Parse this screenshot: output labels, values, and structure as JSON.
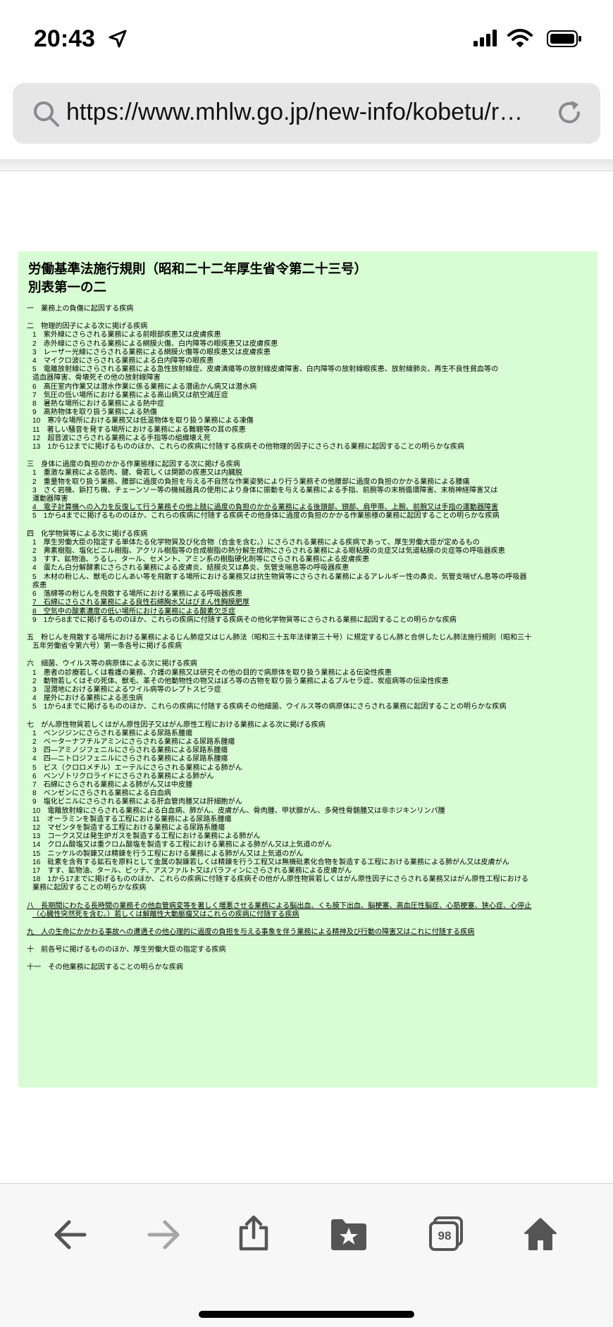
{
  "status_bar": {
    "time": "20:43",
    "location_icon": "location-arrow-icon",
    "signal_icon": "cellular-signal-icon",
    "wifi_icon": "wifi-icon",
    "battery_icon": "battery-icon"
  },
  "browser": {
    "url": "https://www.mhlw.go.jp/new-info/kobetu/r…"
  },
  "colors": {
    "document_bg": "#d8fcd3",
    "urlbar_bg": "#e6e6e7"
  },
  "document": {
    "title_line1": "労働基準法施行規則（昭和二十二年厚生省令第二十三号）",
    "title_line2": "別表第一の二",
    "sections": [
      {
        "lines": [
          {
            "text": "一　業務上の負傷に起因する疾病"
          }
        ]
      },
      {
        "lines": [
          {
            "text": "二　物理的因子による次に掲げる疾病"
          },
          {
            "text": "1　紫外線にさらされる業務による前眼部疾患又は皮膚疾患",
            "cls": "item"
          },
          {
            "text": "2　赤外線にさらされる業務による網膜火傷、白内障等の眼疾患又は皮膚疾患",
            "cls": "item"
          },
          {
            "text": "3　レーザー光線にさらされる業務による網膜火傷等の眼疾患又は皮膚疾患",
            "cls": "item"
          },
          {
            "text": "4　マイクロ波にさらされる業務による白内障等の眼疾患",
            "cls": "item"
          },
          {
            "text": "5　電離放射線にさらされる業務による急性放射線症、皮膚潰瘍等の放射線皮膚障害、白内障等の放射線眼疾患、放射線肺炎、再生不良性貧血等の",
            "cls": "item"
          },
          {
            "text": "造血器障害、骨壊死その他の放射線障害",
            "cls": "cont"
          },
          {
            "text": "6　高圧室内作業又は潜水作業に係る業務による潜函かん病又は潜水病",
            "cls": "item"
          },
          {
            "text": "7　気圧の低い場所における業務による高山病又は航空減圧症",
            "cls": "item"
          },
          {
            "text": "8　暑熱な場所における業務による熱中症",
            "cls": "item"
          },
          {
            "text": "9　高熱物体を取り扱う業務による熱傷",
            "cls": "item"
          },
          {
            "text": "10　寒冷な場所における業務又は低温物体を取り扱う業務による凍傷",
            "cls": "item"
          },
          {
            "text": "11　著しい騒音を発する場所における業務による難聴等の耳の疾患",
            "cls": "item"
          },
          {
            "text": "12　超音波にさらされる業務による手指等の組織壊え死",
            "cls": "item"
          },
          {
            "text": "13　1から12までに掲げるもののほか、これらの疾病に付随する疾病その他物理的因子にさらされる業務に起因することの明らかな疾病",
            "cls": "item"
          }
        ]
      },
      {
        "lines": [
          {
            "text": "三　身体に過度の負担のかかる作業態様に起因する次に掲げる疾病"
          },
          {
            "text": "1　重激な業務による筋肉、腱、骨若しくは関節の疾患又は内臓脱",
            "cls": "item"
          },
          {
            "text": "2　重量物を取り扱う業務、腰部に過度の負担を与える不自然な作業姿勢により行う業務その他腰部に過度の負担のかかる業務による腰痛",
            "cls": "item"
          },
          {
            "text": "3　さく岩機、鋲打ち機、チェーンソー等の機械器具の使用により身体に振動を与える業務による手指、前腕等の末梢循環障害、末梢神経障害又は",
            "cls": "item"
          },
          {
            "text": "運動器障害",
            "cls": "cont"
          },
          {
            "text": "4　電子計算機への入力を反復して行う業務その他上肢に過度の負担のかかる業務による後頭部、頸部、肩甲帯、上腕、前腕又は手指の運動器障害",
            "cls": "item ul"
          },
          {
            "text": "5　1から4までに掲げるもののほか、これらの疾病に付随する疾病その他身体に過度の負担のかかる作業態様の業務に起因することの明らかな疾病",
            "cls": "item"
          }
        ]
      },
      {
        "lines": [
          {
            "text": "四　化学物質等による次に掲げる疾病"
          },
          {
            "text": "1　厚生労働大臣の指定する単体たる化学物質及び化合物（合金を含む。）にさらされる業務による疾病であって、厚生労働大臣が定めるもの",
            "cls": "item"
          },
          {
            "text": "2　弗素樹脂、塩化ビニル樹脂、アクリル樹脂等の合成樹脂の熱分解生成物にさらされる業務による眼粘膜の炎症又は気道粘膜の炎症等の呼吸器疾患",
            "cls": "item"
          },
          {
            "text": "3　すす、鉱物油、うるし、タール、セメント、アミン系の樹脂硬化剤等にさらされる業務による皮膚疾患",
            "cls": "item"
          },
          {
            "text": "4　蛋たん白分解酵素にさらされる業務による皮膚炎、結膜炎又は鼻炎、気管支喘息等の呼吸器疾患",
            "cls": "item"
          },
          {
            "text": "5　木材の粉じん、獣毛のじんあい等を飛散する場所における業務又は抗生物質等にさらされる業務によるアレルギー性の鼻炎、気管支喘ぜん息等の呼吸器",
            "cls": "item"
          },
          {
            "text": "疾患",
            "cls": "cont"
          },
          {
            "text": "6　落綿等の粉じんを飛散する場所における業務による呼吸器疾患",
            "cls": "item"
          },
          {
            "text": "7　石綿にさらされる業務による良性石綿胸水又はびまん性胸膜肥厚",
            "cls": "item ul"
          },
          {
            "text": "8　空気中の酸素濃度の低い場所における業務による酸素欠乏症",
            "cls": "item ul"
          },
          {
            "text": "9　1から8までに掲げるもののほか、これらの疾病に付随する疾病その他化学物質等にさらされる業務に起因することの明らかな疾病",
            "cls": "item"
          }
        ]
      },
      {
        "lines": [
          {
            "text": "五　粉じんを飛散する場所における業務によるじん肺症又はじん肺法（昭和三十五年法律第三十号）に規定するじん肺と合併したじん肺法施行規則（昭和三十"
          },
          {
            "text": "五年労働省令第六号）第一条各号に掲げる疾病",
            "cls": "cont"
          }
        ]
      },
      {
        "lines": [
          {
            "text": "六　細菌、ウイルス等の病原体による次に掲げる疾病"
          },
          {
            "text": "1　患者の診療若しくは看護の業務、介護の業務又は研究その他の目的で病原体を取り扱う業務による伝染性疾患",
            "cls": "item"
          },
          {
            "text": "2　動物若しくはその死体、獣毛、革その他動物性の物又はぼろ等の古物を取り扱う業務によるブルセラ症、炭疽病等の伝染性疾患",
            "cls": "item"
          },
          {
            "text": "3　湿潤地における業務によるワイル病等のレプトスピラ症",
            "cls": "item"
          },
          {
            "text": "4　屋外における業務による恙虫病",
            "cls": "item"
          },
          {
            "text": "5　1から4までに掲げるもののほか、これらの疾病に付随する疾病その他細菌、ウイルス等の病原体にさらされる業務に起因することの明らかな疾病",
            "cls": "item"
          }
        ]
      },
      {
        "lines": [
          {
            "text": "七　がん原性物質若しくはがん原性因子又はがん原性工程における業務による次に掲げる疾病"
          },
          {
            "text": "1　ベンジジンにさらされる業務による尿路系腫瘍",
            "cls": "item"
          },
          {
            "text": "2　ベーターナフチルアミンにさらされる業務による尿路系腫瘍",
            "cls": "item"
          },
          {
            "text": "3　四―アミノジフェニルにさらされる業務による尿路系腫瘍",
            "cls": "item"
          },
          {
            "text": "4　四―ニトロジフェニルにさらされる業務による尿路系腫瘍",
            "cls": "item"
          },
          {
            "text": "5　ビス（クロロメチル）エーテルにさらされる業務による肺がん",
            "cls": "item"
          },
          {
            "text": "6　ベンゾトリクロライドにさらされる業務による肺がん",
            "cls": "item"
          },
          {
            "text": "7　石綿にさらされる業務による肺がん又は中皮腫",
            "cls": "item"
          },
          {
            "text": "8　ベンゼンにさらされる業務による白血病",
            "cls": "item"
          },
          {
            "text": "9　塩化ビニルにさらされる業務による肝血管肉腫又は肝細胞がん",
            "cls": "item"
          },
          {
            "text": "10　電離放射線にさらされる業務による白血病、肺がん、皮膚がん、骨肉腫、甲状腺がん、多発性骨髄腫又は非ホジキンリンパ腫",
            "cls": "item"
          },
          {
            "text": "11　オーラミンを製造する工程における業務による尿路系腫瘍",
            "cls": "item"
          },
          {
            "text": "12　マゼンタを製造する工程における業務による尿路系腫瘍",
            "cls": "item"
          },
          {
            "text": "13　コークス又は発生炉ガスを製造する工程における業務による肺がん",
            "cls": "item"
          },
          {
            "text": "14　クロム酸塩又は重クロム酸塩を製造する工程における業務による肺がん又は上気道のがん",
            "cls": "item"
          },
          {
            "text": "15　ニッケルの製錬又は精錬を行う工程における業務による肺がん又は上気道のがん",
            "cls": "item"
          },
          {
            "text": "16　砒素を含有する鉱石を原料として金属の製錬若しくは精錬を行う工程又は無機砒素化合物を製造する工程における業務による肺がん又は皮膚がん",
            "cls": "item"
          },
          {
            "text": "17　すす、鉱物油、タール、ピッチ、アスファルト又はパラフィンにさらされる業務による皮膚がん",
            "cls": "item"
          },
          {
            "text": "18　1から17までに掲げるもののほか、これらの疾病に付随する疾病その他がん原性物質若しくはがん原性因子にさらされる業務又はがん原性工程における",
            "cls": "item"
          },
          {
            "text": "業務に起因することの明らかな疾病",
            "cls": "cont"
          }
        ]
      },
      {
        "lines": [
          {
            "text": "八　長期間にわたる長時間の業務その他血管病変等を著しく増悪させる業務による脳出血、くも膜下出血、脳梗塞、高血圧性脳症、心筋梗塞、狭心症、心停止",
            "cls": "ul"
          },
          {
            "text": "（心臓性突然死を含む。）若しくは解離性大動脈瘤又はこれらの疾病に付随する疾病",
            "cls": "cont ul"
          }
        ]
      },
      {
        "lines": [
          {
            "text": "九　人の生命にかかわる事故への遭遇その他心理的に過度の負担を与える事象を伴う業務による精神及び行動の障害又はこれに付随する疾病",
            "cls": "ul"
          }
        ]
      },
      {
        "lines": [
          {
            "text": "十　前各号に掲げるもののほか、厚生労働大臣の指定する疾病"
          }
        ]
      },
      {
        "lines": [
          {
            "text": "十一　その他業務に起因することの明らかな疾病"
          }
        ]
      }
    ]
  },
  "toolbar": {
    "tabs_count": "98",
    "back_icon": "back-arrow-icon",
    "forward_icon": "forward-arrow-icon",
    "share_icon": "share-icon",
    "bookmarks_icon": "bookmarks-folder-icon",
    "tabs_icon": "tabs-icon",
    "home_icon": "home-icon"
  }
}
